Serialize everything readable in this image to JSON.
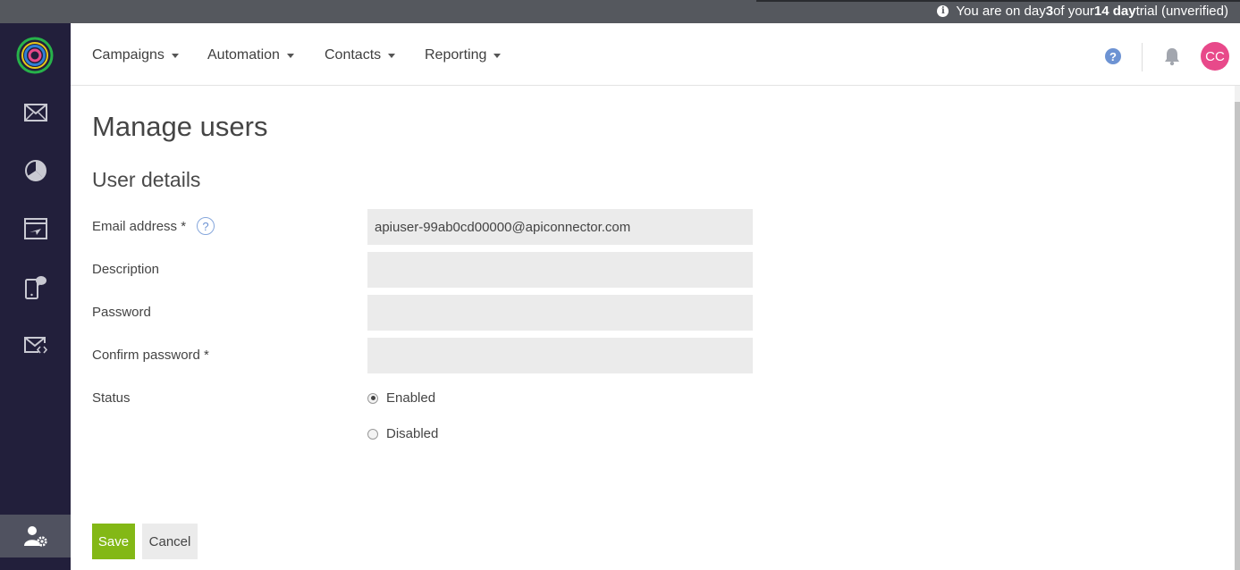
{
  "trial_banner": {
    "prefix": "You are on day ",
    "day": "3",
    "middle": " of your ",
    "length": "14 day",
    "suffix": " trial (unverified)",
    "icon": "info-icon"
  },
  "sidebar": {
    "items": [
      {
        "name": "email-campaigns",
        "icon": "envelope-icon"
      },
      {
        "name": "reporting",
        "icon": "pie-chart-icon"
      },
      {
        "name": "transactional",
        "icon": "window-plane-icon"
      },
      {
        "name": "sms",
        "icon": "mobile-chat-icon"
      },
      {
        "name": "email-code",
        "icon": "envelope-code-icon"
      },
      {
        "name": "manage-users",
        "icon": "user-gear-icon",
        "active": true
      }
    ]
  },
  "nav": {
    "items": [
      {
        "label": "Campaigns"
      },
      {
        "label": "Automation"
      },
      {
        "label": "Contacts"
      },
      {
        "label": "Reporting"
      }
    ],
    "help_glyph": "?",
    "avatar_initials": "CC"
  },
  "page": {
    "title": "Manage users",
    "section_title": "User details"
  },
  "form": {
    "email": {
      "label": "Email address *",
      "value": "apiuser-99ab0cd00000@apiconnector.com",
      "help_glyph": "?"
    },
    "description": {
      "label": "Description",
      "value": ""
    },
    "password": {
      "label": "Password",
      "value": ""
    },
    "confirm_password": {
      "label": "Confirm password *",
      "value": ""
    },
    "status": {
      "label": "Status",
      "options": [
        {
          "label": "Enabled",
          "checked": true
        },
        {
          "label": "Disabled",
          "checked": false
        }
      ]
    }
  },
  "buttons": {
    "save": "Save",
    "cancel": "Cancel"
  },
  "colors": {
    "sidebar": "#221f3b",
    "accent_green": "#83b816",
    "avatar": "#e8498a",
    "help_blue": "#6d93d3",
    "trial_bar": "#55585e"
  }
}
